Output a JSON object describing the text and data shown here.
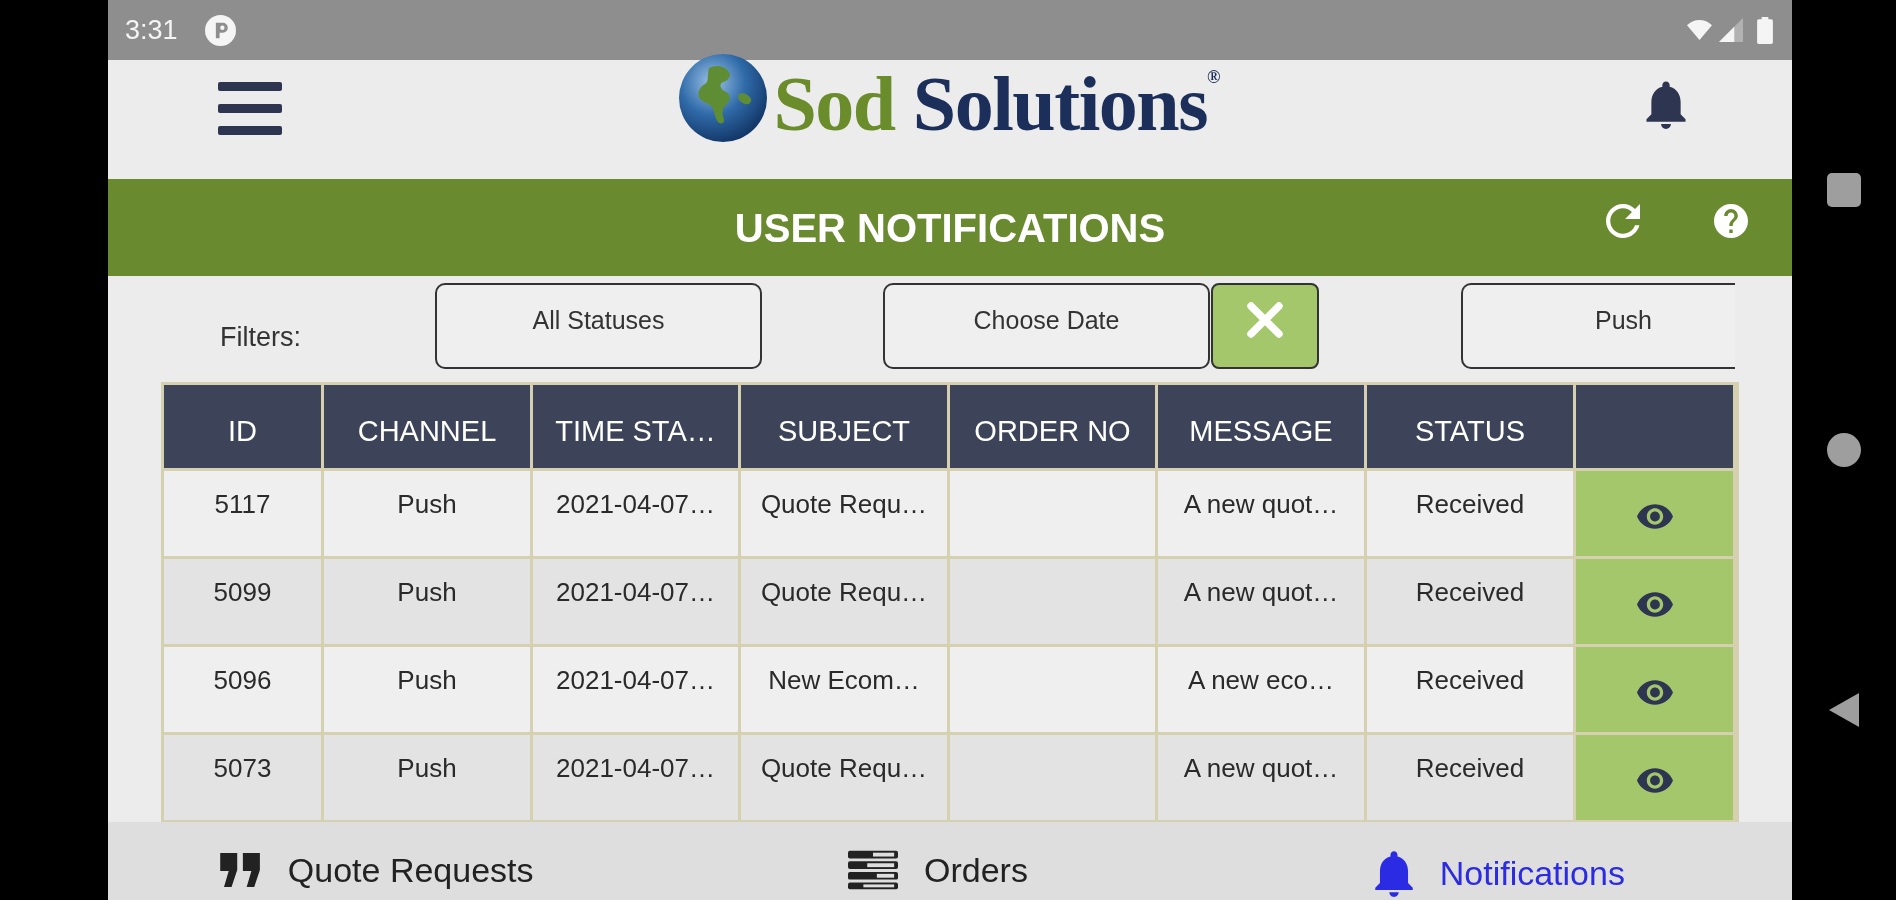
{
  "status_bar": {
    "time": "3:31"
  },
  "header": {
    "logo": {
      "words": [
        "Sod",
        "Solutions"
      ],
      "mark": "®"
    }
  },
  "title_bar": {
    "title": "USER NOTIFICATIONS"
  },
  "filters": {
    "label": "Filters:",
    "controls": [
      {
        "kind": "button",
        "label": "All Statuses"
      },
      {
        "kind": "button",
        "label": "Choose Date"
      },
      {
        "kind": "clear"
      },
      {
        "kind": "cut_button",
        "label": "Push"
      }
    ]
  },
  "table": {
    "columns": [
      "ID",
      "CHANNEL",
      "TIME STA…",
      "SUBJECT",
      "ORDER NO",
      "MESSAGE",
      "STATUS"
    ],
    "rows": [
      {
        "id": "5117",
        "channel": "Push",
        "time_stamp": "2021-04-07…",
        "subject": "Quote Requ…",
        "message": "A new quot…",
        "status": "Received"
      },
      {
        "id": "5099",
        "channel": "Push",
        "time_stamp": "2021-04-07…",
        "subject": "Quote Requ…",
        "message": "A new quot…",
        "status": "Received"
      },
      {
        "id": "5096",
        "channel": "Push",
        "time_stamp": "2021-04-07…",
        "subject": "New Ecom…",
        "message": "A new eco…",
        "status": "Received"
      },
      {
        "id": "5073",
        "channel": "Push",
        "time_stamp": "2021-04-07…",
        "subject": "Quote Requ…",
        "message": "A new quot…",
        "status": "Received"
      }
    ]
  },
  "bottom_nav": {
    "items": [
      {
        "label": "Quote Requests",
        "selected": false
      },
      {
        "label": "Orders",
        "selected": false
      },
      {
        "label": "Notifications",
        "selected": true
      }
    ]
  }
}
